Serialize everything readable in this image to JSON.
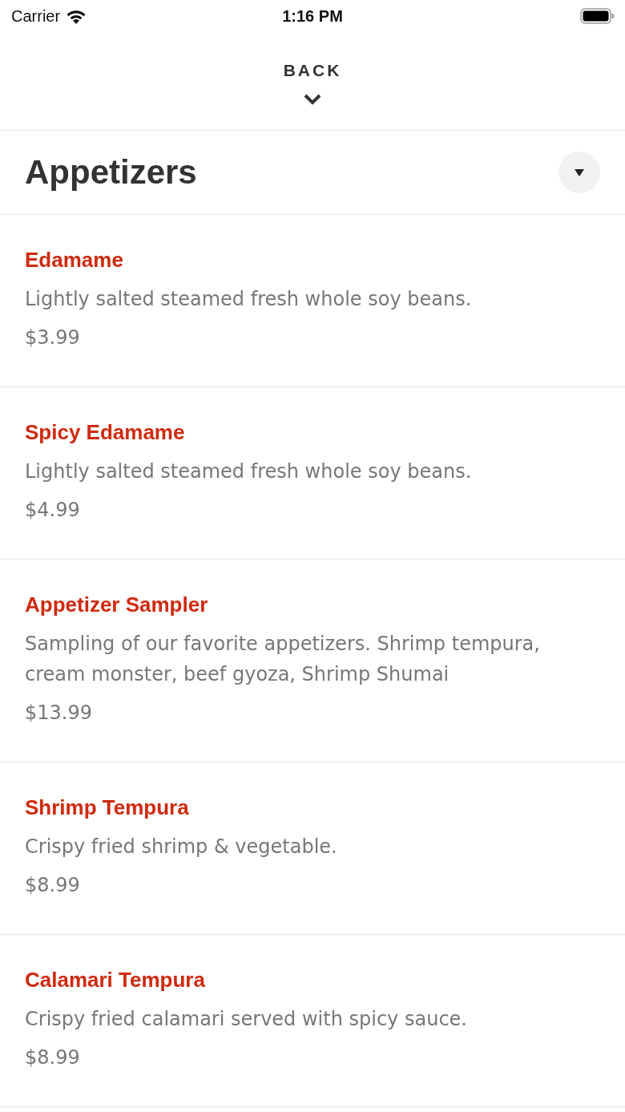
{
  "status_bar": {
    "carrier": "Carrier",
    "time": "1:16 PM"
  },
  "back": {
    "label": "BACK"
  },
  "category": {
    "title": "Appetizers"
  },
  "items": [
    {
      "name": "Edamame",
      "description": "Lightly salted steamed fresh whole soy beans.",
      "price": "$3.99"
    },
    {
      "name": "Spicy Edamame",
      "description": "Lightly salted steamed fresh whole soy beans.",
      "price": "$4.99"
    },
    {
      "name": "Appetizer Sampler",
      "description": "Sampling of our favorite appetizers. Shrimp tempura, cream monster, beef gyoza, Shrimp Shumai",
      "price": "$13.99"
    },
    {
      "name": "Shrimp Tempura",
      "description": "Crispy fried shrimp & vegetable.",
      "price": "$8.99"
    },
    {
      "name": "Calamari Tempura",
      "description": "Crispy fried calamari served with spicy sauce.",
      "price": "$8.99"
    }
  ]
}
